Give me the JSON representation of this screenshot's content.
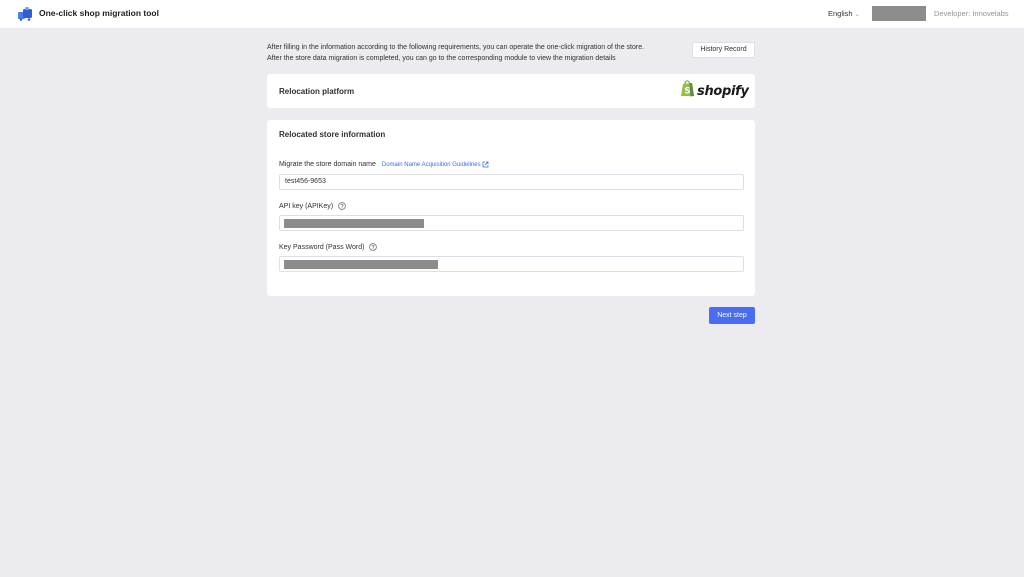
{
  "header": {
    "app_title": "One-click shop migration tool",
    "language": "English",
    "developer": "Developer: Innovelabs"
  },
  "intro": {
    "line1": "After filling in the information according to the following requirements, you can operate the one-click migration of the store.",
    "line2": "After the store data migration is completed, you can go to the corresponding module to view the migration details"
  },
  "history_button": "History Record",
  "platform_card": {
    "title": "Relocation platform",
    "platform_logo_text": "shopify"
  },
  "store_card": {
    "title": "Relocated store information",
    "domain_label": "Migrate the store domain name",
    "domain_guide_link": "Domain Name Acquisition Guidelines",
    "domain_value": "test456-9653",
    "api_key_label": "API key (APIKey)",
    "password_label": "Key Password (Pass Word)"
  },
  "next_button": "Next step",
  "colors": {
    "primary": "#4a6cf0",
    "link": "#3b6fe0",
    "background": "#ebebf0",
    "shopify_green": "#95bf47"
  },
  "icons": [
    "app-logo-icon",
    "chevron-down-icon",
    "external-link-icon",
    "help-circle-icon",
    "shopify-bag-icon"
  ]
}
